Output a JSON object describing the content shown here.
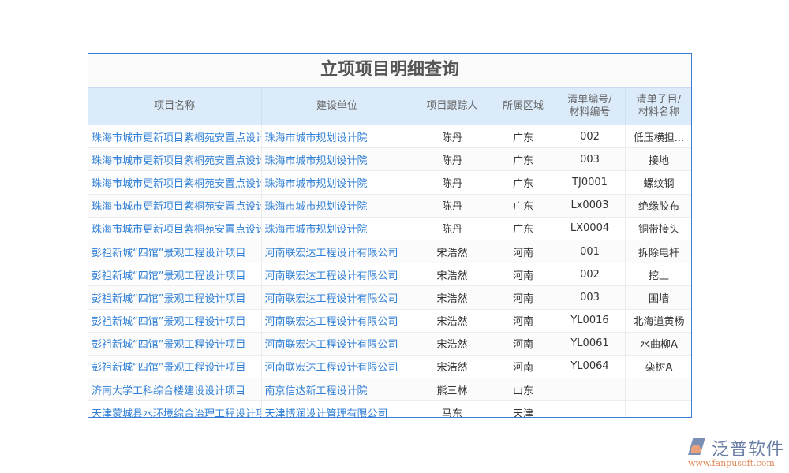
{
  "title": "立项项目明细查询",
  "columns": [
    "项目名称",
    "建设单位",
    "项目跟踪人",
    "所属区域",
    "清单编号/\n材料编号",
    "清单子目/\n材料名称"
  ],
  "rows": [
    [
      "珠海市城市更新项目紫桐苑安置点设计",
      "珠海市城市规划设计院",
      "陈丹",
      "广东",
      "002",
      "低压横担..."
    ],
    [
      "珠海市城市更新项目紫桐苑安置点设计",
      "珠海市城市规划设计院",
      "陈丹",
      "广东",
      "003",
      "接地"
    ],
    [
      "珠海市城市更新项目紫桐苑安置点设计",
      "珠海市城市规划设计院",
      "陈丹",
      "广东",
      "TJ0001",
      "螺纹钢"
    ],
    [
      "珠海市城市更新项目紫桐苑安置点设计",
      "珠海市城市规划设计院",
      "陈丹",
      "广东",
      "Lx0003",
      "绝缘胶布"
    ],
    [
      "珠海市城市更新项目紫桐苑安置点设计",
      "珠海市城市规划设计院",
      "陈丹",
      "广东",
      "LX0004",
      "铜带接头"
    ],
    [
      "彭祖新城“四馆”景观工程设计项目",
      "河南联宏达工程设计有限公司",
      "宋浩然",
      "河南",
      "001",
      "拆除电杆"
    ],
    [
      "彭祖新城“四馆”景观工程设计项目",
      "河南联宏达工程设计有限公司",
      "宋浩然",
      "河南",
      "002",
      "挖土"
    ],
    [
      "彭祖新城“四馆”景观工程设计项目",
      "河南联宏达工程设计有限公司",
      "宋浩然",
      "河南",
      "003",
      "围墙"
    ],
    [
      "彭祖新城“四馆”景观工程设计项目",
      "河南联宏达工程设计有限公司",
      "宋浩然",
      "河南",
      "YL0016",
      "北海道黄杨"
    ],
    [
      "彭祖新城“四馆”景观工程设计项目",
      "河南联宏达工程设计有限公司",
      "宋浩然",
      "河南",
      "YL0061",
      "水曲柳A"
    ],
    [
      "彭祖新城“四馆”景观工程设计项目",
      "河南联宏达工程设计有限公司",
      "宋浩然",
      "河南",
      "YL0064",
      "栾树A"
    ],
    [
      "济南大学工科综合楼建设设计项目",
      "南京信达新工程设计院",
      "熊三林",
      "山东",
      "",
      ""
    ],
    [
      "天津蒙城县水环境综合治理工程设计项目",
      "天津博润设计管理有限公司",
      "马东",
      "天津",
      "",
      ""
    ]
  ],
  "logo": {
    "name": "泛普软件",
    "url": "www.fanpusoft.com"
  },
  "colors": {
    "border": "#3a7bd5",
    "header_bg": "#dcebfa",
    "link": "#2f7fd6"
  }
}
